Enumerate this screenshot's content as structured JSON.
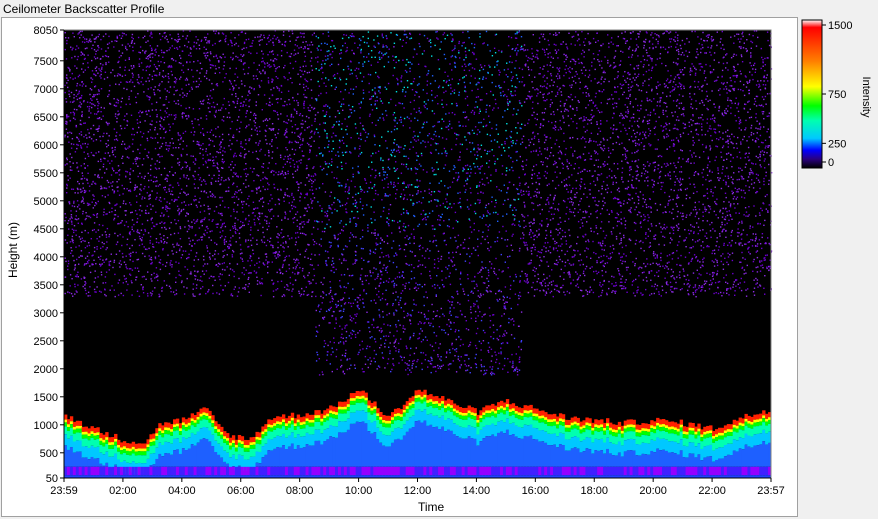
{
  "window": {
    "title": "Ceilometer Backscatter Profile"
  },
  "chart_data": {
    "type": "heatmap",
    "title": "Ceilometer Backscatter Profile",
    "xlabel": "Time",
    "ylabel": "Height (m)",
    "x_ticks": [
      "23:59",
      "02:00",
      "04:00",
      "06:00",
      "08:00",
      "10:00",
      "12:00",
      "14:00",
      "16:00",
      "18:00",
      "20:00",
      "22:00",
      "23:57"
    ],
    "y_ticks": [
      50,
      500,
      1000,
      1500,
      2000,
      2500,
      3000,
      3500,
      4000,
      4500,
      5000,
      5500,
      6000,
      6500,
      7000,
      7500,
      8050
    ],
    "ylim": [
      50,
      8050
    ],
    "x_range_hours": [
      -0.0167,
      23.95
    ],
    "colorbar": {
      "label": "Intensity",
      "ticks": [
        1500,
        750,
        250,
        0
      ],
      "colors": [
        "#000000",
        "#2a0080",
        "#8b00ff",
        "#0000ff",
        "#00c8ff",
        "#00ffb0",
        "#00ff00",
        "#ffff00",
        "#ff8000",
        "#ff0000",
        "#ffffff"
      ]
    },
    "background_color": "#000000",
    "boundary_layer_top_m": [
      {
        "time_h": 0.0,
        "height": 1150
      },
      {
        "time_h": 1.0,
        "height": 900
      },
      {
        "time_h": 2.0,
        "height": 700
      },
      {
        "time_h": 2.7,
        "height": 650
      },
      {
        "time_h": 3.3,
        "height": 1000
      },
      {
        "time_h": 4.0,
        "height": 1050
      },
      {
        "time_h": 4.8,
        "height": 1250
      },
      {
        "time_h": 5.5,
        "height": 800
      },
      {
        "time_h": 6.3,
        "height": 700
      },
      {
        "time_h": 7.0,
        "height": 1100
      },
      {
        "time_h": 8.0,
        "height": 1150
      },
      {
        "time_h": 9.0,
        "height": 1250
      },
      {
        "time_h": 10.0,
        "height": 1600
      },
      {
        "time_h": 11.0,
        "height": 1100
      },
      {
        "time_h": 12.0,
        "height": 1600
      },
      {
        "time_h": 13.0,
        "height": 1400
      },
      {
        "time_h": 14.0,
        "height": 1200
      },
      {
        "time_h": 14.9,
        "height": 1400
      },
      {
        "time_h": 16.0,
        "height": 1250
      },
      {
        "time_h": 17.0,
        "height": 1100
      },
      {
        "time_h": 18.0,
        "height": 1050
      },
      {
        "time_h": 19.0,
        "height": 1000
      },
      {
        "time_h": 20.0,
        "height": 1050
      },
      {
        "time_h": 21.0,
        "height": 1000
      },
      {
        "time_h": 22.0,
        "height": 900
      },
      {
        "time_h": 23.0,
        "height": 1100
      },
      {
        "time_h": 23.95,
        "height": 1250
      }
    ],
    "aerosol_scatter_top_m": 8050,
    "enhanced_upper_signal_window_h": [
      8.5,
      15.5
    ]
  }
}
